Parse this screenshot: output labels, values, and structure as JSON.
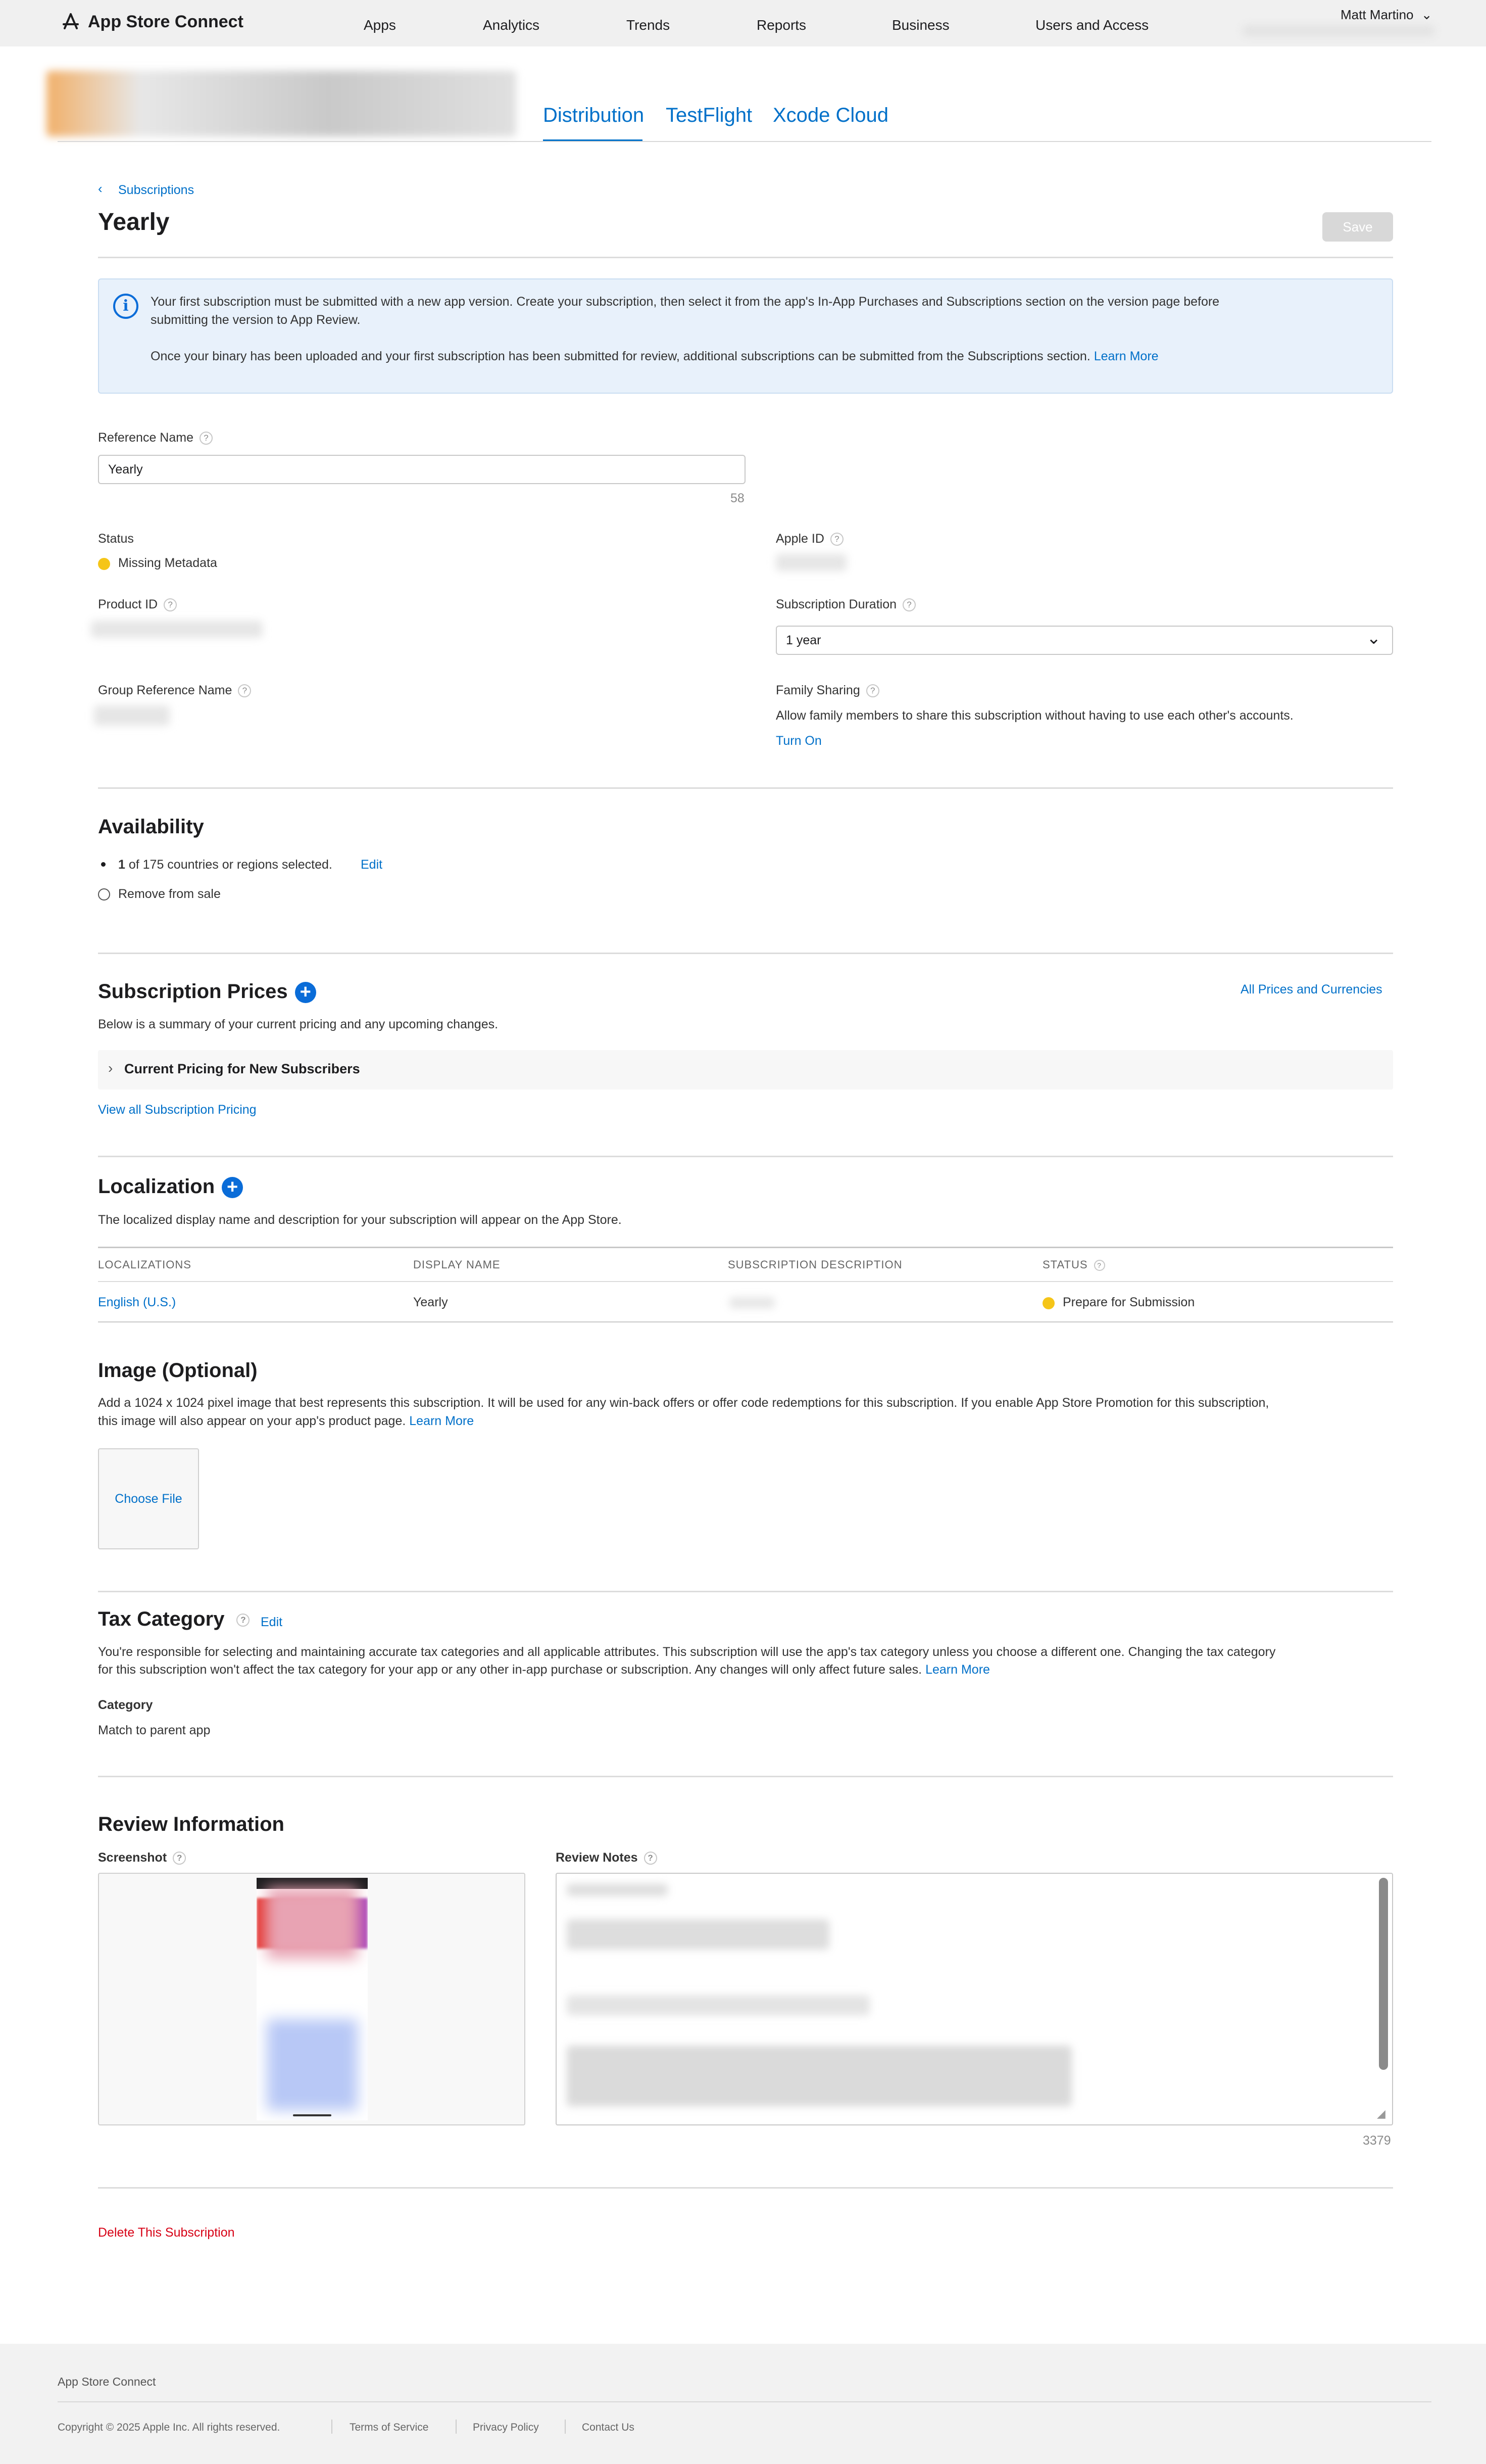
{
  "topnav": {
    "brand": "App Store Connect",
    "items": [
      "Apps",
      "Analytics",
      "Trends",
      "Reports",
      "Business",
      "Users and Access"
    ],
    "user": "Matt Martino"
  },
  "app_tabs": [
    "Distribution",
    "TestFlight",
    "Xcode Cloud"
  ],
  "breadcrumb": "Subscriptions",
  "page_title": "Yearly",
  "save_label": "Save",
  "info": {
    "line1": "Your first subscription must be submitted with a new app version. Create your subscription, then select it from the app's In-App Purchases and Subscriptions section on the version page before",
    "line1b": "submitting the version to App Review.",
    "line2": "Once your binary has been uploaded and your first subscription has been submitted for review, additional subscriptions can be submitted from the Subscriptions section.",
    "learn_more": "Learn More"
  },
  "form": {
    "reference_name_label": "Reference Name",
    "reference_name_value": "Yearly",
    "reference_name_count": "58",
    "status_label": "Status",
    "status_value": "Missing Metadata",
    "apple_id_label": "Apple ID",
    "product_id_label": "Product ID",
    "duration_label": "Subscription Duration",
    "duration_value": "1 year",
    "group_label": "Group Reference Name",
    "family_label": "Family Sharing",
    "family_desc": "Allow family members to share this subscription without having to use each other's accounts.",
    "family_action": "Turn On"
  },
  "availability": {
    "title": "Availability",
    "count_bold": "1",
    "count_rest": "of 175 countries or regions selected.",
    "edit": "Edit",
    "remove": "Remove from sale"
  },
  "prices": {
    "title": "Subscription Prices",
    "all_prices": "All Prices and Currencies",
    "desc": "Below is a summary of your current pricing and any upcoming changes.",
    "current": "Current Pricing for New Subscribers",
    "view_all": "View all Subscription Pricing"
  },
  "localization": {
    "title": "Localization",
    "desc": "The localized display name and description for your subscription will appear on the App Store.",
    "headers": [
      "LOCALIZATIONS",
      "DISPLAY NAME",
      "SUBSCRIPTION DESCRIPTION",
      "STATUS"
    ],
    "row": {
      "locale": "English (U.S.)",
      "display_name": "Yearly",
      "status": "Prepare for Submission"
    }
  },
  "image": {
    "title": "Image (Optional)",
    "desc1": "Add a 1024 x 1024 pixel image that best represents this subscription. It will be used for any win-back offers or offer code redemptions for this subscription. If you enable App Store Promotion for this subscription,",
    "desc2": "this image will also appear on your app's product page.",
    "learn_more": "Learn More",
    "choose": "Choose File"
  },
  "tax": {
    "title": "Tax Category",
    "edit": "Edit",
    "desc1": "You're responsible for selecting and maintaining accurate tax categories and all applicable attributes. This subscription will use the app's tax category unless you choose a different one. Changing the tax category",
    "desc2": "for this subscription won't affect the tax category for your app or any other in-app purchase or subscription. Any changes will only affect future sales.",
    "learn_more": "Learn More",
    "category_label": "Category",
    "category_value": "Match to parent app"
  },
  "review": {
    "title": "Review Information",
    "screenshot_label": "Screenshot",
    "notes_label": "Review Notes",
    "notes_count": "3379"
  },
  "delete_label": "Delete This Subscription",
  "footer": {
    "brand": "App Store Connect",
    "copyright": "Copyright © 2025 Apple Inc. All rights reserved.",
    "links": [
      "Terms of Service",
      "Privacy Policy",
      "Contact Us"
    ]
  },
  "colors": {
    "accent": "#0070c9",
    "status_yellow": "#f5c518",
    "danger": "#d70015"
  }
}
